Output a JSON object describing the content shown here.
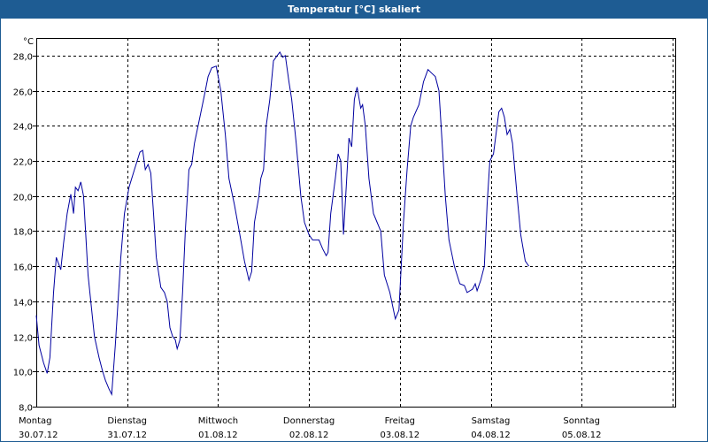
{
  "window": {
    "title": "Temperatur [°C] skaliert"
  },
  "colors": {
    "titlebar": "#1e5c93",
    "line": "#0000a0",
    "grid": "#000000"
  },
  "chart_data": {
    "type": "line",
    "title": "Temperatur [°C] skaliert",
    "ylabel": "°C",
    "xlabel": "",
    "ylim": [
      8,
      29
    ],
    "yticks": [
      8,
      10,
      12,
      14,
      16,
      18,
      20,
      22,
      24,
      26,
      28
    ],
    "ytick_labels": [
      "8,0",
      "10,0",
      "12,0",
      "14,0",
      "16,0",
      "18,0",
      "20,0",
      "22,0",
      "24,0",
      "26,0",
      "28,0"
    ],
    "xlim": [
      0,
      7.0
    ],
    "x_unit": "days from 30.07.12 00:00",
    "days": [
      {
        "weekday": "Montag",
        "date": "30.07.12"
      },
      {
        "weekday": "Dienstag",
        "date": "31.07.12"
      },
      {
        "weekday": "Mittwoch",
        "date": "01.08.12"
      },
      {
        "weekday": "Donnerstag",
        "date": "02.08.12"
      },
      {
        "weekday": "Freitag",
        "date": "03.08.12"
      },
      {
        "weekday": "Samstag",
        "date": "04.08.12"
      },
      {
        "weekday": "Sonntag",
        "date": "05.08.12"
      }
    ],
    "grid": true,
    "series": [
      {
        "values": [
          [
            0.0,
            13.2
          ],
          [
            0.03,
            11.5
          ],
          [
            0.08,
            10.5
          ],
          [
            0.12,
            9.9
          ],
          [
            0.15,
            10.8
          ],
          [
            0.19,
            14.5
          ],
          [
            0.22,
            16.5
          ],
          [
            0.27,
            15.8
          ],
          [
            0.3,
            17.3
          ],
          [
            0.34,
            19.0
          ],
          [
            0.38,
            20.1
          ],
          [
            0.41,
            19.0
          ],
          [
            0.43,
            20.5
          ],
          [
            0.46,
            20.3
          ],
          [
            0.49,
            20.8
          ],
          [
            0.52,
            20.0
          ],
          [
            0.57,
            15.5
          ],
          [
            0.64,
            12.0
          ],
          [
            0.69,
            10.8
          ],
          [
            0.73,
            10.0
          ],
          [
            0.76,
            9.5
          ],
          [
            0.8,
            9.0
          ],
          [
            0.83,
            8.7
          ],
          [
            0.87,
            11.5
          ],
          [
            0.93,
            16.5
          ],
          [
            0.97,
            19.0
          ],
          [
            1.02,
            20.5
          ],
          [
            1.08,
            21.5
          ],
          [
            1.14,
            22.5
          ],
          [
            1.17,
            22.6
          ],
          [
            1.2,
            21.5
          ],
          [
            1.23,
            21.8
          ],
          [
            1.26,
            21.3
          ],
          [
            1.29,
            19.0
          ],
          [
            1.32,
            16.5
          ],
          [
            1.37,
            14.8
          ],
          [
            1.41,
            14.5
          ],
          [
            1.44,
            14.0
          ],
          [
            1.47,
            12.5
          ],
          [
            1.5,
            12.0
          ],
          [
            1.53,
            11.8
          ],
          [
            1.55,
            11.3
          ],
          [
            1.58,
            11.8
          ],
          [
            1.61,
            14.5
          ],
          [
            1.64,
            18.0
          ],
          [
            1.68,
            21.5
          ],
          [
            1.71,
            21.8
          ],
          [
            1.74,
            23.0
          ],
          [
            1.8,
            24.5
          ],
          [
            1.86,
            26.0
          ],
          [
            1.89,
            26.8
          ],
          [
            1.93,
            27.3
          ],
          [
            1.98,
            27.4
          ],
          [
            2.03,
            26.0
          ],
          [
            2.08,
            23.5
          ],
          [
            2.12,
            21.0
          ],
          [
            2.18,
            19.5
          ],
          [
            2.24,
            17.8
          ],
          [
            2.29,
            16.3
          ],
          [
            2.34,
            15.2
          ],
          [
            2.37,
            15.7
          ],
          [
            2.4,
            18.5
          ],
          [
            2.45,
            20.0
          ],
          [
            2.47,
            21.0
          ],
          [
            2.5,
            21.5
          ],
          [
            2.53,
            24.0
          ],
          [
            2.57,
            25.5
          ],
          [
            2.61,
            27.7
          ],
          [
            2.65,
            28.0
          ],
          [
            2.68,
            28.2
          ],
          [
            2.71,
            27.9
          ],
          [
            2.74,
            28.0
          ],
          [
            2.78,
            26.5
          ],
          [
            2.81,
            25.5
          ],
          [
            2.86,
            23.0
          ],
          [
            2.91,
            20.0
          ],
          [
            2.95,
            18.5
          ],
          [
            3.0,
            17.8
          ],
          [
            3.04,
            17.5
          ],
          [
            3.11,
            17.5
          ],
          [
            3.15,
            17.0
          ],
          [
            3.19,
            16.6
          ],
          [
            3.21,
            16.8
          ],
          [
            3.24,
            19.0
          ],
          [
            3.29,
            21.0
          ],
          [
            3.32,
            22.4
          ],
          [
            3.35,
            22.0
          ],
          [
            3.38,
            17.8
          ],
          [
            3.41,
            20.5
          ],
          [
            3.44,
            23.3
          ],
          [
            3.47,
            22.8
          ],
          [
            3.5,
            25.5
          ],
          [
            3.53,
            26.2
          ],
          [
            3.57,
            25.0
          ],
          [
            3.59,
            25.2
          ],
          [
            3.62,
            24.0
          ],
          [
            3.66,
            21.0
          ],
          [
            3.71,
            19.0
          ],
          [
            3.75,
            18.5
          ],
          [
            3.79,
            18.0
          ],
          [
            3.83,
            15.5
          ],
          [
            3.89,
            14.5
          ],
          [
            3.95,
            13.0
          ],
          [
            3.99,
            13.5
          ],
          [
            4.04,
            18.5
          ],
          [
            4.08,
            21.5
          ],
          [
            4.12,
            24.0
          ],
          [
            4.15,
            24.5
          ],
          [
            4.21,
            25.2
          ],
          [
            4.26,
            26.5
          ],
          [
            4.31,
            27.2
          ],
          [
            4.35,
            27.0
          ],
          [
            4.39,
            26.8
          ],
          [
            4.43,
            26.0
          ],
          [
            4.46,
            23.5
          ],
          [
            4.5,
            20.0
          ],
          [
            4.54,
            17.5
          ],
          [
            4.6,
            16.0
          ],
          [
            4.63,
            15.5
          ],
          [
            4.66,
            15.0
          ],
          [
            4.71,
            14.9
          ],
          [
            4.74,
            14.5
          ],
          [
            4.8,
            14.7
          ],
          [
            4.83,
            15.0
          ],
          [
            4.85,
            14.6
          ],
          [
            4.89,
            15.2
          ],
          [
            4.93,
            16.0
          ],
          [
            4.96,
            19.5
          ],
          [
            4.99,
            22.0
          ],
          [
            5.03,
            22.4
          ],
          [
            5.09,
            24.8
          ],
          [
            5.12,
            25.0
          ],
          [
            5.15,
            24.5
          ],
          [
            5.18,
            23.5
          ],
          [
            5.21,
            23.8
          ],
          [
            5.24,
            23.0
          ],
          [
            5.29,
            20.0
          ],
          [
            5.33,
            17.8
          ],
          [
            5.38,
            16.3
          ],
          [
            5.42,
            16.0
          ]
        ]
      }
    ]
  }
}
